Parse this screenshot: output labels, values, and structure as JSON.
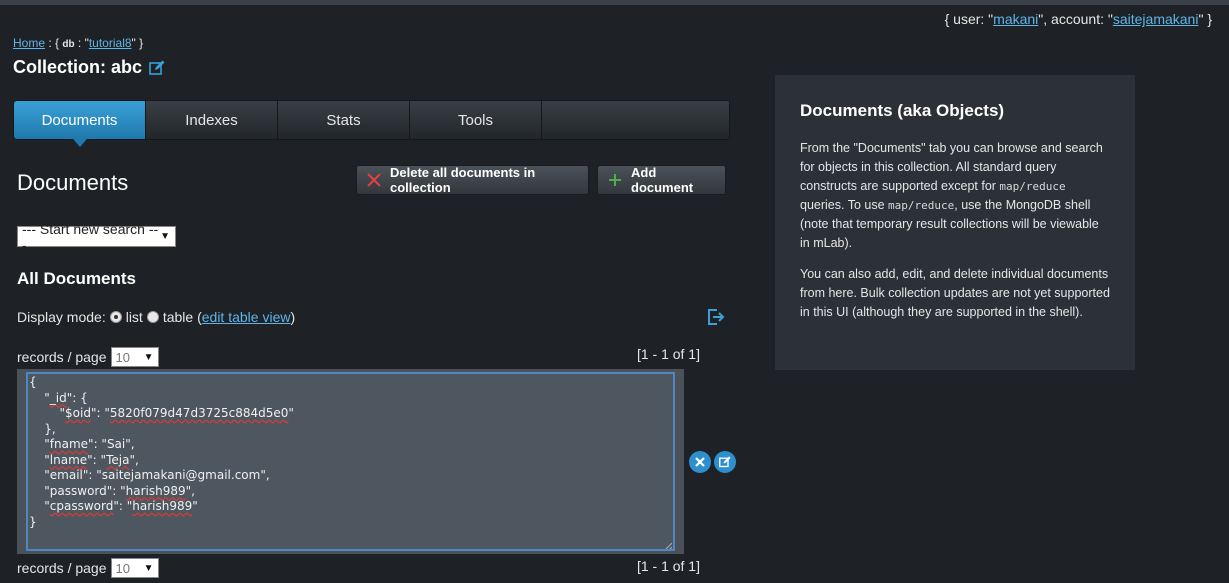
{
  "user_info": {
    "open": "{ user: \"",
    "user": "makani",
    "mid": "\", account: \"",
    "account": "saitejamakani",
    "close": "\" }"
  },
  "breadcrumb": {
    "home": "Home",
    "sep": " : { ",
    "db_key": "db",
    "db_mid": " : \"",
    "db_name": "tutorial8",
    "db_close": "\" }"
  },
  "collection": {
    "prefix": "Collection: ",
    "name": "abc"
  },
  "tabs": [
    {
      "label": "Documents",
      "active": true
    },
    {
      "label": "Indexes",
      "active": false
    },
    {
      "label": "Stats",
      "active": false
    },
    {
      "label": "Tools",
      "active": false
    }
  ],
  "documents_section": {
    "title": "Documents",
    "delete_all_label": "Delete all documents in collection",
    "add_label": "Add document"
  },
  "search": {
    "selected": "--- Start new search ---"
  },
  "all_documents": {
    "title": "All Documents",
    "display_mode_label": "Display mode:",
    "mode_list": "list",
    "mode_table": "table",
    "edit_open": "(",
    "edit_table_view": "edit table view",
    "edit_close": ")",
    "records_per_page_label": "records / page",
    "records_per_page_value": "10",
    "range_text": "[1 - 1 of 1]"
  },
  "document": {
    "lines": {
      "l1": "{",
      "l2_a": "    \"",
      "l2_key": "_id",
      "l2_b": "\": {",
      "l3_a": "        \"",
      "l3_key": "$oid",
      "l3_b": "\": \"",
      "l3_val": "5820f079d47d3725c884d5e0",
      "l3_c": "\"",
      "l4": "    },",
      "l5_a": "    \"",
      "l5_key": "fname",
      "l5_b": "\": \"Sai\",",
      "l6_a": "    \"",
      "l6_key": "lname",
      "l6_b": "\": \"",
      "l6_val": "Teja",
      "l6_c": "\",",
      "l7": "    \"email\": \"saitejamakani@gmail.com\",",
      "l8_a": "    \"password\": \"",
      "l8_val": "harish989",
      "l8_c": "\",",
      "l9_a": "    \"",
      "l9_key": "cpassword",
      "l9_b": "\": \"",
      "l9_val": "harish989",
      "l9_c": "\"",
      "l10": "}"
    }
  },
  "help": {
    "title": "Documents (aka Objects)",
    "p1_a": "From the \"Documents\" tab you can browse and search for objects in this collection. All standard query constructs are supported except for ",
    "p1_code1": "map/reduce",
    "p1_b": " queries. To use ",
    "p1_code2": "map/reduce",
    "p1_c": ", use the MongoDB shell (note that temporary result collections will be viewable in mLab).",
    "p2": "You can also add, edit, and delete individual documents from here. Bulk collection updates are not yet supported in this UI (although they are supported in the shell)."
  },
  "icons": {
    "edit": "edit-icon",
    "delete_x": "close-icon",
    "add_plus": "plus-icon",
    "export": "export-icon"
  },
  "colors": {
    "accent": "#2e8fcf",
    "link": "#5fb5e8",
    "delete_red": "#e34141",
    "add_green": "#4cb050"
  }
}
